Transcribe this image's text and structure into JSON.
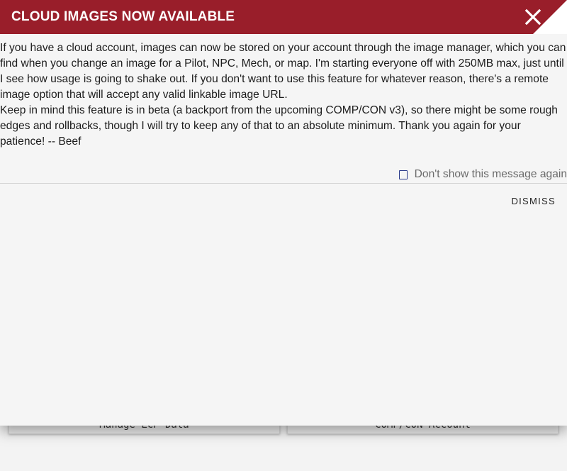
{
  "background": {
    "buttons": [
      {
        "label": "Manage LCP Data"
      },
      {
        "label": "COMP/CON Account"
      }
    ]
  },
  "dialog": {
    "title": "CLOUD IMAGES NOW AVAILABLE",
    "close_icon": "close-icon",
    "paragraphs": [
      "If you have a cloud account, images can now be stored on your account through the image manager, which you can find when you change an image for a Pilot, NPC, Mech, or map. I'm starting everyone off with 250MB max, just until I see how usage is going to shake out. If you don't want to use this feature for whatever reason, there's a remote image option that will accept any valid linkable image URL.",
      "Keep in mind this feature is in beta (a backport from the upcoming COMP/CON v3), so there might be some rough edges and rollbacks, though I will try to keep any of that to an absolute minimum. Thank you again for your patience! -- Beef"
    ],
    "dont_show_label": "Don't show this message again",
    "dismiss_label": "DISMISS"
  },
  "colors": {
    "header": "#991e2a",
    "checkbox": "#2a3a8a"
  }
}
